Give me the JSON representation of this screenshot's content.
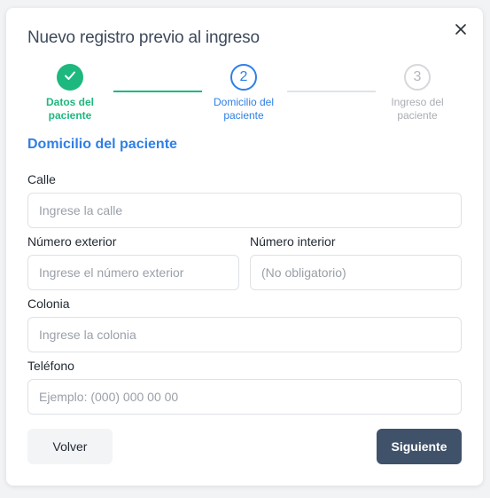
{
  "modal": {
    "title": "Nuevo registro previo al ingreso",
    "close_icon": "close-icon"
  },
  "stepper": {
    "steps": [
      {
        "number": "1",
        "label_line1": "Datos del",
        "label_line2": "paciente",
        "state": "completed",
        "icon": "check-icon"
      },
      {
        "number": "2",
        "label_line1": "Domicilio del",
        "label_line2": "paciente",
        "state": "active"
      },
      {
        "number": "3",
        "label_line1": "Ingreso del",
        "label_line2": "paciente",
        "state": "pending"
      }
    ],
    "colors": {
      "completed": "#1db87e",
      "active": "#2f7fe6",
      "pending": "#b3b7bd"
    }
  },
  "section": {
    "title": "Domicilio del paciente"
  },
  "form": {
    "calle": {
      "label": "Calle",
      "placeholder": "Ingrese la calle",
      "value": ""
    },
    "numero_exterior": {
      "label": "Número exterior",
      "placeholder": "Ingrese el número exterior",
      "value": ""
    },
    "numero_interior": {
      "label": "Número interior",
      "placeholder": "(No obligatorio)",
      "value": ""
    },
    "colonia": {
      "label": "Colonia",
      "placeholder": "Ingrese la colonia",
      "value": ""
    },
    "telefono": {
      "label": "Teléfono",
      "placeholder": "Ejemplo: (000) 000 00 00",
      "value": ""
    }
  },
  "actions": {
    "back_label": "Volver",
    "next_label": "Siguiente",
    "next_color": "#3f5269"
  }
}
